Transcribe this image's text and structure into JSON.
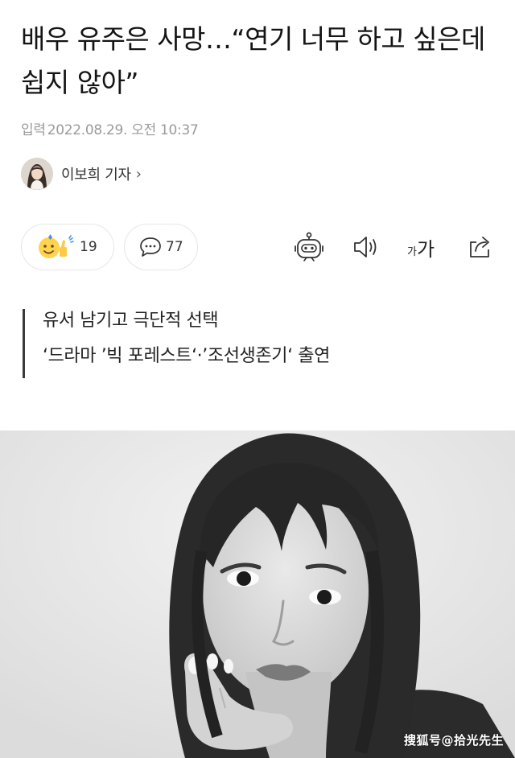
{
  "article": {
    "headline": "배우 유주은 사망…“연기 너무 하고 싶은데 쉽지 않아”",
    "date_prefix": "입력",
    "date_value": "2022.08.29. 오전 10:37"
  },
  "reporter": {
    "name": "이보희 기자",
    "chevron": "›"
  },
  "actions": {
    "reaction_count": "19",
    "comment_count": "77",
    "font_small": "가",
    "font_big": "가"
  },
  "subheadings": [
    "유서 남기고 극단적 선택",
    "‘드라마 ’빅 포레스트‘·’조선생존기‘ 출연"
  ],
  "watermark": "搜狐号@拾光先生",
  "icons": {
    "reaction": "emoji-thumbsup-icon",
    "comment": "speech-bubble-icon",
    "bot": "robot-icon",
    "speaker": "speaker-icon",
    "share": "share-icon"
  }
}
